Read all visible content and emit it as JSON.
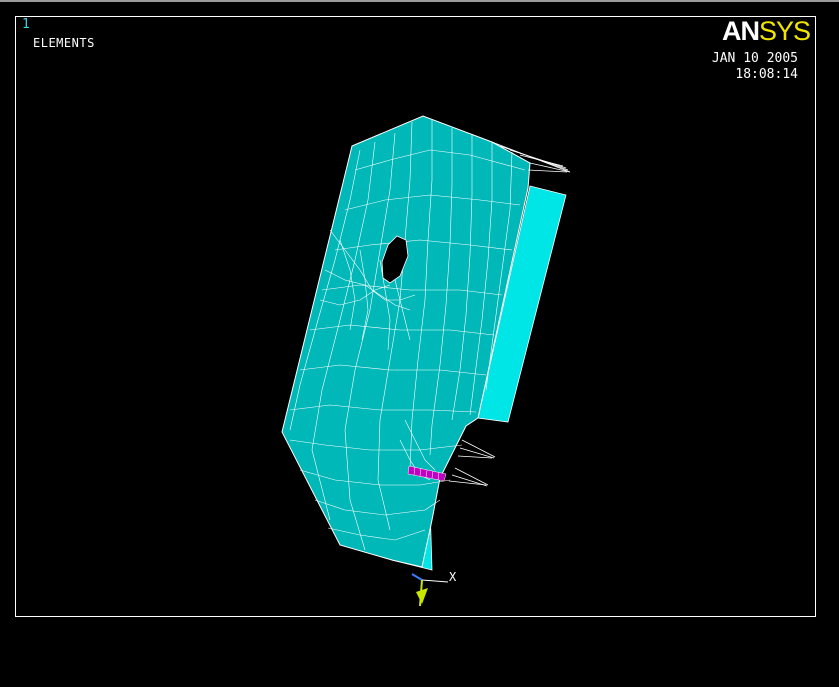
{
  "window": {
    "number": "1",
    "plot_label": "ELEMENTS"
  },
  "logo": {
    "part1": "AN",
    "part2": "SYS"
  },
  "timestamp": {
    "date": "JAN 10 2005",
    "time": "18:08:14"
  },
  "triad": {
    "x_label": "X"
  },
  "colors": {
    "background": "#000000",
    "mesh_face": "#00b8b8",
    "mesh_face_light": "#00e6e6",
    "mesh_lines": "#ffffff",
    "highlight_elements": "#c000c0",
    "logo_yellow": "#f2e500",
    "window_number": "#3ad0e0"
  },
  "icons": {
    "triad": "coordinate-triad-icon"
  }
}
